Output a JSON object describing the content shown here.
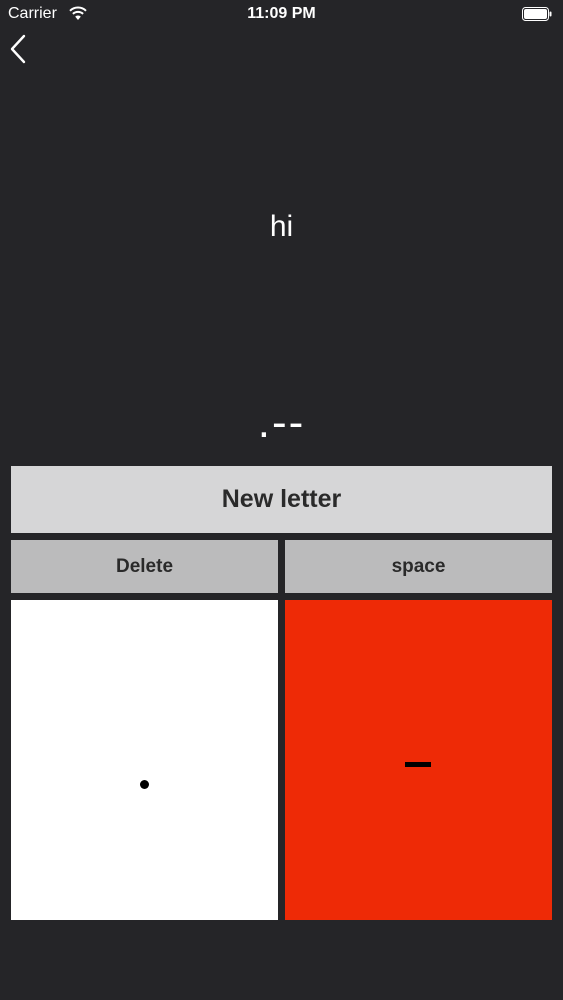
{
  "status_bar": {
    "carrier": "Carrier",
    "time": "11:09 PM",
    "wifi_icon": "wifi-icon",
    "battery_icon": "battery-icon"
  },
  "nav": {
    "back_icon": "chevron-left-icon"
  },
  "output": {
    "decoded_text": "hi",
    "current_morse": ".--"
  },
  "controls": {
    "new_letter_label": "New letter",
    "delete_label": "Delete",
    "space_label": "space",
    "dot_symbol_icon": "dot-icon",
    "dash_symbol_icon": "dash-icon"
  },
  "colors": {
    "background": "#252528",
    "new_letter_bg": "#d6d6d7",
    "secondary_bg": "#bbbbbc",
    "dot_bg": "#ffffff",
    "dash_bg": "#ee2a06"
  }
}
